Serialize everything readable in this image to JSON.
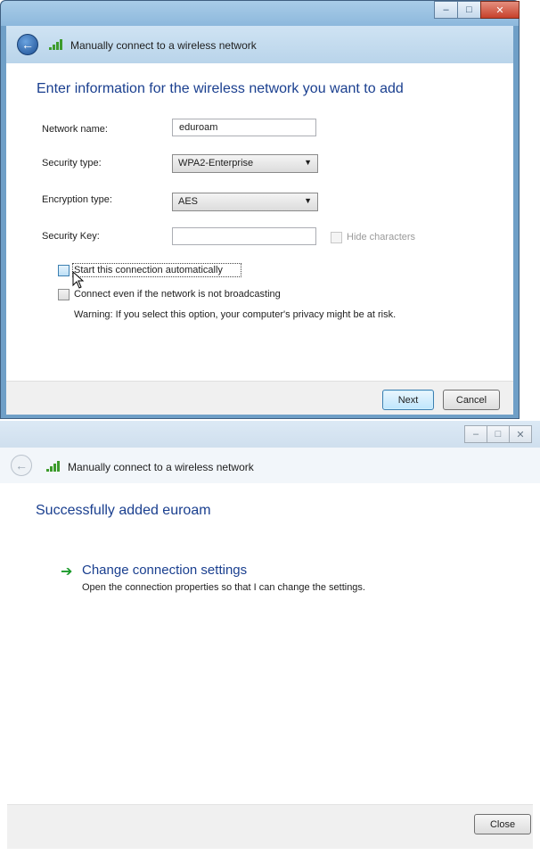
{
  "window1": {
    "title": "Manually connect to a wireless network",
    "heading": "Enter information for the wireless network you want to add",
    "network_name": {
      "label": "Network name:",
      "value": "eduroam"
    },
    "security_type": {
      "label": "Security type:",
      "value": "WPA2-Enterprise"
    },
    "encryption_type": {
      "label": "Encryption type:",
      "value": "AES"
    },
    "security_key": {
      "label": "Security Key:",
      "value": ""
    },
    "hide_characters": "Hide characters",
    "start_automatically": "Start this connection automatically",
    "connect_even": "Connect even if the network is not broadcasting",
    "warning": "Warning: If you select this option, your computer's privacy might be at risk.",
    "next_button": "Next",
    "cancel_button": "Cancel"
  },
  "window2": {
    "title": "Manually connect to a wireless network",
    "heading": "Successfully added euroam",
    "link_title": "Change connection settings",
    "link_desc": "Open the connection properties so that I can change the settings.",
    "close_button": "Close"
  },
  "icons": {
    "back": "back-arrow-icon",
    "wifi": "wireless-signal-icon",
    "minimize": "minimize-icon",
    "maximize": "maximize-icon",
    "close": "close-icon",
    "link_arrow": "green-arrow-icon"
  },
  "colors": {
    "heading": "#1a3f8f",
    "link_arrow": "#1a9a2a",
    "close_button": "#c7412b"
  }
}
